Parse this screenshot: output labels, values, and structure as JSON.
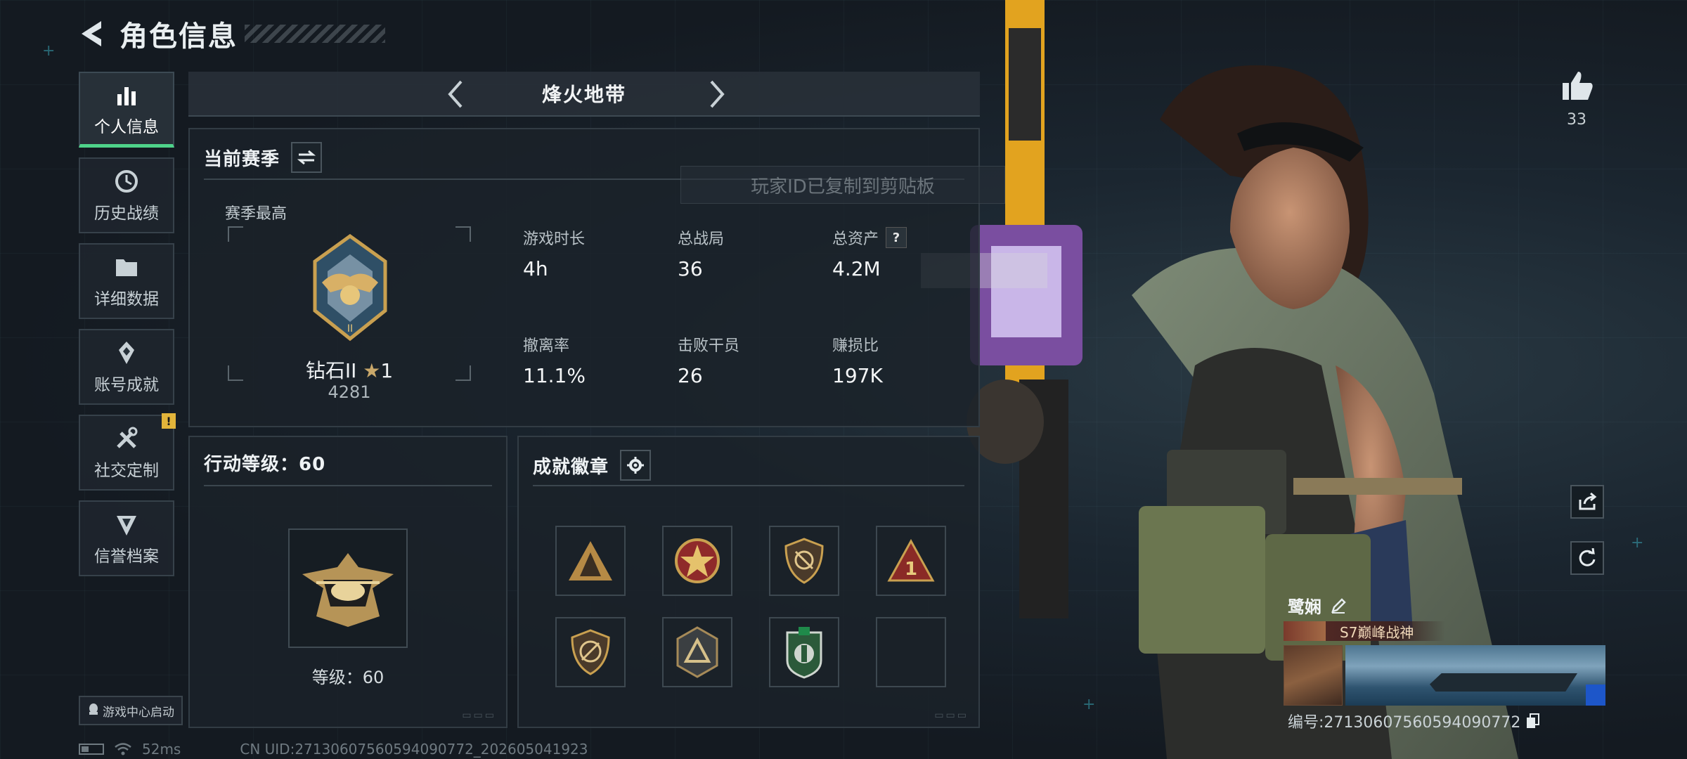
{
  "header": {
    "title": "角色信息"
  },
  "sidebar": {
    "items": [
      {
        "label": "个人信息",
        "icon": "bar-chart-icon",
        "active": true
      },
      {
        "label": "历史战绩",
        "icon": "history-clock-icon"
      },
      {
        "label": "详细数据",
        "icon": "folder-icon"
      },
      {
        "label": "账号成就",
        "icon": "achievement-icon"
      },
      {
        "label": "社交定制",
        "icon": "tools-icon",
        "badge": "!"
      },
      {
        "label": "信誉档案",
        "icon": "credit-shield-icon"
      }
    ],
    "launch_label": "游戏中心启动"
  },
  "mode_bar": {
    "title": "烽火地带"
  },
  "season_panel": {
    "title": "当前赛季",
    "season_best_label": "赛季最高",
    "rank_name": "钻石II",
    "rank_stars": "1",
    "rank_score": "4281",
    "stats": [
      {
        "label": "游戏时长",
        "value": "4h"
      },
      {
        "label": "总战局",
        "value": "36"
      },
      {
        "label": "总资产",
        "value": "4.2M",
        "help": "?"
      },
      {
        "label": "撤离率",
        "value": "11.1%"
      },
      {
        "label": "击败干员",
        "value": "26"
      },
      {
        "label": "赚损比",
        "value": "197K"
      }
    ]
  },
  "toast": {
    "text": "玩家ID已复制到剪贴板"
  },
  "level_panel": {
    "title": "行动等级：60",
    "level_text": "等级：60"
  },
  "badge_panel": {
    "title": "成就徽章",
    "slots": [
      "team-triangle-badge",
      "red-star-badge",
      "crossed-shield-badge",
      "rank-one-badge",
      "no-weapon-shield-badge",
      "triangle-shield-badge",
      "green-emblem-badge",
      "empty-slot"
    ]
  },
  "right": {
    "like_count": "33",
    "player_name": "鹭娴",
    "title_tag": "S7巅峰战神",
    "uid_label": "编号:271306075605940907​72",
    "status_uid": "CN UID:271306075605940907​72_202605041923",
    "ping": "52ms"
  },
  "colors": {
    "accent_green": "#4ed38a",
    "warning": "#e2b43a",
    "panel_bg": "#1b222a"
  }
}
